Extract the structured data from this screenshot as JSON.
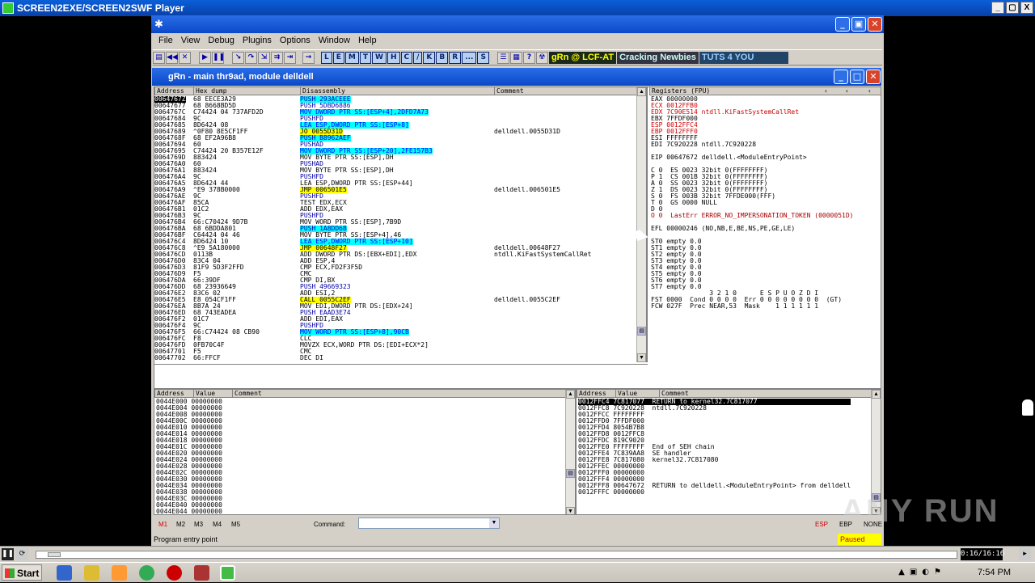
{
  "player": {
    "title": "SCREEN2EXE/SCREEN2SWF Player",
    "controls": [
      "_",
      "▢",
      "X"
    ]
  },
  "olly": {
    "menu": [
      "File",
      "View",
      "Debug",
      "Plugins",
      "Options",
      "Window",
      "Help"
    ],
    "toolbar_letters": [
      "L",
      "E",
      "M",
      "T",
      "W",
      "H",
      "C",
      "/",
      "K",
      "B",
      "R",
      "...",
      "S"
    ],
    "toolbar_banners": [
      "gRn @ LCF-AT",
      "Cracking Newbies",
      "TUTS 4 YOU"
    ],
    "cpu_title": "gRn - main thr9ad, module delldell",
    "dis_headers": [
      "Address",
      "Hex dump",
      "Disassembly",
      "Comment"
    ],
    "regs_header": "Registers (FPU)",
    "disasm": [
      [
        "0064767Z",
        "68 EECE3A29",
        "PUSH 293ACEEE",
        ""
      ],
      [
        "00647677",
        "68 8668BD5D",
        "PUSH 5DBD6886",
        ""
      ],
      [
        "0064767C",
        "C74424 04 737AFD2D",
        "MOV DWORD PTR SS:[ESP+4],2DFD7A73",
        ""
      ],
      [
        "00647684",
        "9C",
        "PUSHFD",
        ""
      ],
      [
        "00647685",
        "8D6424 08",
        "LEA ESP,DWORD PTR SS:[ESP+8]",
        ""
      ],
      [
        "00647689",
        "^0F80 8E5CF1FF",
        "JO 0055D31D",
        "delldell.0055D31D"
      ],
      [
        "0064768F",
        "68 EF2A96B8",
        "PUSH B8962AEF",
        ""
      ],
      [
        "00647694",
        "60",
        "PUSHAD",
        ""
      ],
      [
        "00647695",
        "C74424 20 B357E12F",
        "MOV DWORD PTR SS:[ESP+20],2FE157B3",
        ""
      ],
      [
        "0064769D",
        "883424",
        "MOV BYTE PTR SS:[ESP],DH",
        ""
      ],
      [
        "006476A0",
        "60",
        "PUSHAD",
        ""
      ],
      [
        "006476A1",
        "883424",
        "MOV BYTE PTR SS:[ESP],DH",
        ""
      ],
      [
        "006476A4",
        "9C",
        "PUSHFD",
        ""
      ],
      [
        "006476A5",
        "8D6424 44",
        "LEA ESP,DWORD PTR SS:[ESP+44]",
        ""
      ],
      [
        "006476A9",
        "^E9 378B0000",
        "JMP 006501E5",
        "delldell.006501E5"
      ],
      [
        "006476AE",
        "9C",
        "PUSHFD",
        ""
      ],
      [
        "006476AF",
        "85CA",
        "TEST EDX,ECX",
        ""
      ],
      [
        "006476B1",
        "01C2",
        "ADD EDX,EAX",
        ""
      ],
      [
        "006476B3",
        "9C",
        "PUSHFD",
        ""
      ],
      [
        "006476B4",
        "66:C70424 9D7B",
        "MOV WORD PTR SS:[ESP],7B9D",
        ""
      ],
      [
        "006476BA",
        "68 6BDDA801",
        "PUSH 1A8DD6B",
        ""
      ],
      [
        "006476BF",
        "C64424 04 46",
        "MOV BYTE PTR SS:[ESP+4],46",
        ""
      ],
      [
        "006476C4",
        "8D6424 10",
        "LEA ESP,DWORD PTR SS:[ESP+10]",
        ""
      ],
      [
        "006476C8",
        "^E9 5A180000",
        "JMP 00648F27",
        "delldell.00648F27"
      ],
      [
        "006476CD",
        "0113B",
        "ADD DWORD PTR DS:[EBX+EDI],EDX",
        "ntdll.KiFastSystemCallRet"
      ],
      [
        "006476D0",
        "83C4 04",
        "ADD ESP,4",
        ""
      ],
      [
        "006476D3",
        "81F9 5D3F2FFD",
        "CMP ECX,FD2F3F5D",
        ""
      ],
      [
        "006476D9",
        "F5",
        "CMC",
        ""
      ],
      [
        "006476DA",
        "66:39DF",
        "CMP DI,BX",
        ""
      ],
      [
        "006476DD",
        "68 23936649",
        "PUSH 49669323",
        ""
      ],
      [
        "006476E2",
        "83C6 02",
        "ADD ESI,2",
        ""
      ],
      [
        "006476E5",
        "E8 054CF1FF",
        "CALL 0055C2EF",
        "delldell.0055C2EF"
      ],
      [
        "006476EA",
        "8B7A 24",
        "MOV EDI,DWORD PTR DS:[EDX+24]",
        ""
      ],
      [
        "006476ED",
        "68 743EADEA",
        "PUSH EAAD3E74",
        ""
      ],
      [
        "006476F2",
        "01C7",
        "ADD EDI,EAX",
        ""
      ],
      [
        "006476F4",
        "9C",
        "PUSHFD",
        ""
      ],
      [
        "006476F5",
        "66:C74424 08 CB90",
        "MOV WORD PTR SS:[ESP+8],90CB",
        ""
      ],
      [
        "006476FC",
        "F8",
        "CLC",
        ""
      ],
      [
        "006476FD",
        "0FB70C4F",
        "MOVZX ECX,WORD PTR DS:[EDI+ECX*2]",
        ""
      ],
      [
        "00647701",
        "F5",
        "CMC",
        ""
      ],
      [
        "00647702",
        "66:FFCF",
        "DEC DI",
        ""
      ]
    ],
    "registers": [
      "EAX 00000000",
      "ECX 0012FFB0",
      "EDX 7C90E514 ntdll.KiFastSystemCallRet",
      "EBX 7FFDF000",
      "ESP 0012FFC4",
      "EBP 0012FFF0",
      "ESI FFFFFFFF",
      "EDI 7C920228 ntdll.7C920228",
      "",
      "EIP 00647672 delldell.<ModuleEntryPoint>",
      "",
      "C 0  ES 0023 32bit 0(FFFFFFFF)",
      "P 1  CS 001B 32bit 0(FFFFFFFF)",
      "A 0  SS 0023 32bit 0(FFFFFFFF)",
      "Z 1  DS 0023 32bit 0(FFFFFFFF)",
      "S 0  FS 003B 32bit 7FFDE000(FFF)",
      "T 0  GS 0000 NULL",
      "D 0",
      "O 0  LastErr ERROR_NO_IMPERSONATION_TOKEN (0000051D)",
      "",
      "EFL 00000246 (NO,NB,E,BE,NS,PE,GE,LE)",
      "",
      "ST0 empty 0.0",
      "ST1 empty 0.0",
      "ST2 empty 0.0",
      "ST3 empty 0.0",
      "ST4 empty 0.0",
      "ST5 empty 0.0",
      "ST6 empty 0.0",
      "ST7 empty 0.0",
      "               3 2 1 0      E S P U O Z D I",
      "FST 0000  Cond 0 0 0 0  Err 0 0 0 0 0 0 0 0  (GT)",
      "FCW 027F  Prec NEAR,53  Mask    1 1 1 1 1 1"
    ],
    "dump_headers": [
      "Address",
      "Value",
      "Comment"
    ],
    "dump": [
      [
        "0044E000",
        "00000000"
      ],
      [
        "0044E004",
        "00000000"
      ],
      [
        "0044E008",
        "00000000"
      ],
      [
        "0044E00C",
        "00000000"
      ],
      [
        "0044E010",
        "00000000"
      ],
      [
        "0044E014",
        "00000000"
      ],
      [
        "0044E018",
        "00000000"
      ],
      [
        "0044E01C",
        "00000000"
      ],
      [
        "0044E020",
        "00000000"
      ],
      [
        "0044E024",
        "00000000"
      ],
      [
        "0044E028",
        "00000000"
      ],
      [
        "0044E02C",
        "00000000"
      ],
      [
        "0044E030",
        "00000000"
      ],
      [
        "0044E034",
        "00000000"
      ],
      [
        "0044E038",
        "00000000"
      ],
      [
        "0044E03C",
        "00000000"
      ],
      [
        "0044E040",
        "00000000"
      ],
      [
        "0044E044",
        "00000000"
      ]
    ],
    "stack": [
      [
        "0012FFC4",
        "7C817077",
        "RETURN to kernel32.7C817077"
      ],
      [
        "0012FFC8",
        "7C920228",
        "ntdll.7C920228"
      ],
      [
        "0012FFCC",
        "FFFFFFFF",
        ""
      ],
      [
        "0012FFD0",
        "7FFDF000",
        ""
      ],
      [
        "0012FFD4",
        "8054B7B8",
        ""
      ],
      [
        "0012FFD8",
        "0012FFC8",
        ""
      ],
      [
        "0012FFDC",
        "819C9020",
        ""
      ],
      [
        "0012FFE0",
        "FFFFFFFF",
        "End of SEH chain"
      ],
      [
        "0012FFE4",
        "7C839AA8",
        "SE handler"
      ],
      [
        "0012FFE8",
        "7C817080",
        "kernel32.7C817080"
      ],
      [
        "0012FFEC",
        "00000000",
        ""
      ],
      [
        "0012FFF0",
        "00000000",
        ""
      ],
      [
        "0012FFF4",
        "00000000",
        ""
      ],
      [
        "0012FFF8",
        "00647672",
        "RETURN to delldell.<ModuleEntryPoint> from delldell"
      ],
      [
        "0012FFFC",
        "00000000",
        ""
      ]
    ],
    "bottom_tabs": [
      "M1",
      "M2",
      "M3",
      "M4",
      "M5"
    ],
    "command_label": "Command:",
    "bottom_right": [
      "ESP",
      "EBP",
      "NONE"
    ],
    "status_text": "Program entry point",
    "paused": "Paused"
  },
  "scrub": {
    "time": "0:16/16:16"
  },
  "taskbar": {
    "start": "Start",
    "clock": "7:54 PM"
  },
  "watermark": "ANY RUN"
}
